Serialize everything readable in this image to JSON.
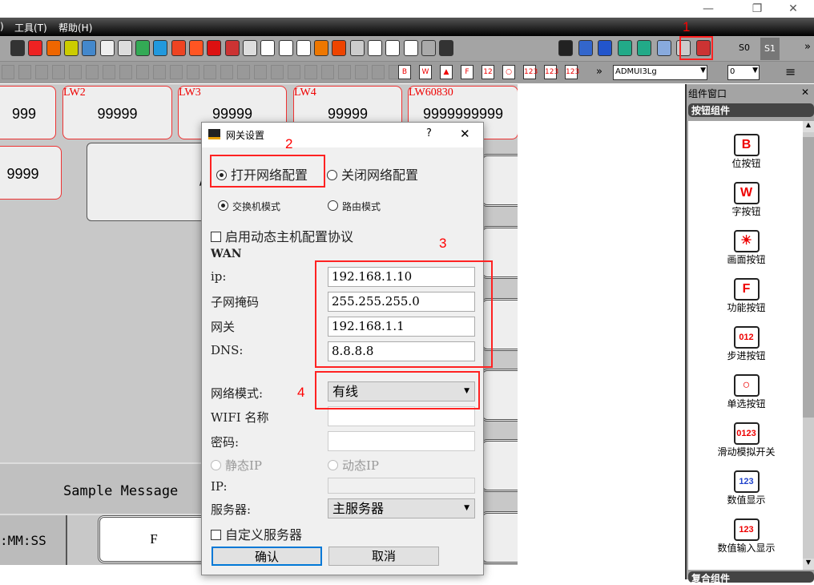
{
  "window": {
    "minimize": "—",
    "restore": "❐",
    "close": "✕"
  },
  "menu": {
    "partial": ")",
    "tools": "工具(T)",
    "help": "帮助(H)"
  },
  "toolbar1": {
    "icons": [
      {
        "name": "record-list-icon",
        "color": "#333"
      },
      {
        "name": "alarm-light-icon",
        "color": "#e22"
      },
      {
        "name": "function-f-icon",
        "color": "#e60"
      },
      {
        "name": "indicator-lamp-icon",
        "color": "#cc0"
      },
      {
        "name": "clock-icon",
        "color": "#48c"
      },
      {
        "name": "date-icon",
        "color": "#eee"
      },
      {
        "name": "week-icon",
        "color": "#ddd"
      },
      {
        "name": "picture-icon",
        "color": "#3a5"
      },
      {
        "name": "gif-icon",
        "color": "#29d"
      },
      {
        "name": "lamp-icon",
        "color": "#e42"
      },
      {
        "name": "toggle-icon",
        "color": "#f52"
      },
      {
        "name": "bar-icon",
        "color": "#d11"
      },
      {
        "name": "cylinder-icon",
        "color": "#c33"
      },
      {
        "name": "meter-icon",
        "color": "#ddd"
      },
      {
        "name": "trend-chart-icon",
        "color": "#fff"
      },
      {
        "name": "xy-chart-icon",
        "color": "#fff"
      },
      {
        "name": "histogram-icon",
        "color": "#fff"
      },
      {
        "name": "alarm-icon",
        "color": "#e70"
      },
      {
        "name": "alarm-event-icon",
        "color": "#e40"
      },
      {
        "name": "keypad-icon",
        "color": "#ccc"
      },
      {
        "name": "history-trend-icon",
        "color": "#fff"
      },
      {
        "name": "history-xy-icon",
        "color": "#fff"
      },
      {
        "name": "history-bar-icon",
        "color": "#fff"
      },
      {
        "name": "pipe-icon",
        "color": "#aaa"
      },
      {
        "name": "monitor-icon",
        "color": "#333"
      }
    ],
    "tools": [
      {
        "name": "tools-icon",
        "color": "#222"
      },
      {
        "name": "compile-icon",
        "color": "#36c"
      },
      {
        "name": "simulate-icon",
        "color": "#25c"
      },
      {
        "name": "download-icon",
        "color": "#2a8"
      },
      {
        "name": "upload-icon",
        "color": "#2a8"
      },
      {
        "name": "network-icon",
        "color": "#8ad"
      },
      {
        "name": "gateway-settings-icon",
        "color": "#ccc"
      },
      {
        "name": "pen-icon",
        "color": "#c33"
      }
    ],
    "s0": "S0",
    "s1": "S1",
    "more": "»"
  },
  "toolbar2": {
    "buttons": [
      {
        "name": "bit-button-icon",
        "glyph": "B"
      },
      {
        "name": "word-button-icon",
        "glyph": "W"
      },
      {
        "name": "screen-button-icon",
        "glyph": "▲"
      },
      {
        "name": "function-button-icon",
        "glyph": "F"
      },
      {
        "name": "step-button-icon",
        "glyph": "12"
      },
      {
        "name": "radio-button-icon",
        "glyph": "○"
      },
      {
        "name": "slider-icon",
        "glyph": "123"
      },
      {
        "name": "number-display-icon",
        "glyph": "123"
      },
      {
        "name": "number-input-icon",
        "glyph": "123"
      }
    ],
    "font": "ADMUI3Lg",
    "size": "0",
    "more": "»",
    "align": "≡"
  },
  "canvas": {
    "lw_boxes": [
      {
        "label": "",
        "value": "999"
      },
      {
        "label": "LW2",
        "value": "99999"
      },
      {
        "label": "LW3",
        "value": "99999"
      },
      {
        "label": "LW4",
        "value": "99999"
      },
      {
        "label": "LW60830",
        "value": "9999999999"
      }
    ],
    "row2_value": "9999",
    "big_box_text": "/",
    "sample_message": "Sample Message",
    "time": ":MM:SS",
    "f_button": "F"
  },
  "panel": {
    "title": "组件窗口",
    "close": "✕",
    "group": "按钮组件",
    "next_group": "复合组件",
    "items": [
      {
        "label": "位按钮",
        "glyph": "B"
      },
      {
        "label": "字按钮",
        "glyph": "W"
      },
      {
        "label": "画面按钮",
        "glyph": "☀"
      },
      {
        "label": "功能按钮",
        "glyph": "F"
      },
      {
        "label": "步进按钮",
        "glyph": "012"
      },
      {
        "label": "单选按钮",
        "glyph": "○"
      },
      {
        "label": "滑动模拟开关",
        "glyph": "0123"
      },
      {
        "label": "数值显示",
        "glyph": "123"
      },
      {
        "label": "数值输入显示",
        "glyph": "123"
      }
    ]
  },
  "annotations": [
    "1",
    "2",
    "3",
    "4"
  ],
  "dialog": {
    "title": "网关设置",
    "help": "?",
    "close": "✕",
    "open_network": "打开网络配置",
    "close_network": "关闭网络配置",
    "switch_mode": "交换机模式",
    "router_mode": "路由模式",
    "dhcp": "启用动态主机配置协议",
    "wan": "WAN",
    "ip_label": "ip:",
    "ip": "192.168.1.10",
    "mask_label": "子网掩码",
    "mask": "255.255.255.0",
    "gateway_label": "网关",
    "gateway": "192.168.1.1",
    "dns_label": "DNS:",
    "dns": "8.8.8.8",
    "net_mode_label": "网络模式:",
    "net_mode": "有线",
    "wifi_label": "WIFI 名称",
    "wifi": "",
    "pwd_label": "密码:",
    "pwd": "",
    "static_ip": "静态IP",
    "dynamic_ip": "动态IP",
    "ip2_label": "IP:",
    "ip2": "",
    "server_label": "服务器:",
    "server": "主服务器",
    "custom_server": "自定义服务器",
    "ok": "确认",
    "cancel": "取消"
  }
}
